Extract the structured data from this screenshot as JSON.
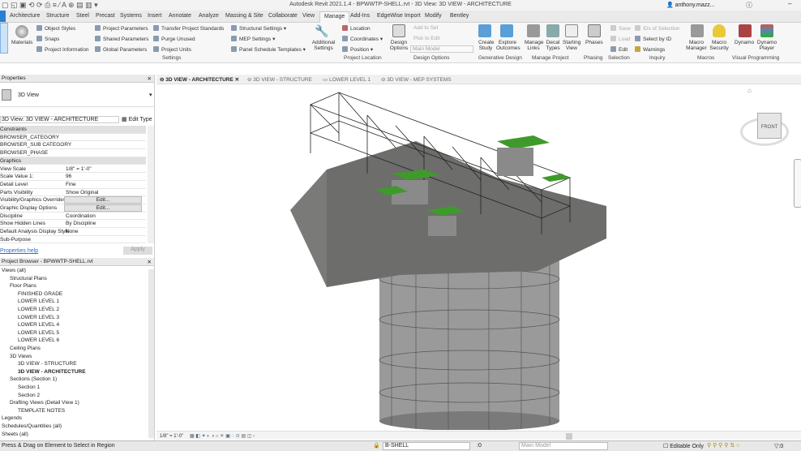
{
  "window": {
    "title": "Autodesk Revit 2021.1.4 - BPWWTP-SHELL.rvt - 3D View: 3D VIEW - ARCHITECTURE",
    "user": "anthony.mazz...",
    "help": "?"
  },
  "tabs": [
    "Architecture",
    "Structure",
    "Steel",
    "Precast",
    "Systems",
    "Insert",
    "Annotate",
    "Analyze",
    "Massing & Site",
    "Collaborate",
    "View",
    "Manage",
    "Add-Ins",
    "EdgeWise Import",
    "Modify",
    "Bentley"
  ],
  "active_tab": "Manage",
  "ribbon": {
    "modify": "Modify",
    "materials": "Materials",
    "settings_items": [
      "Object Styles",
      "Snaps",
      "Project Information",
      "Project Parameters",
      "Shared Parameters",
      "Global Parameters",
      "Transfer Project Standards",
      "Purge Unused",
      "Project Units",
      "Structural Settings",
      "MEP Settings",
      "Panel Schedule Templates"
    ],
    "additional_settings": "Additional Settings",
    "settings_group": "Settings",
    "location_items": [
      "Location",
      "Coordinates",
      "Position"
    ],
    "project_location_group": "Project Location",
    "design_options": "Design Options",
    "add_to_set": "Add to Set",
    "pick_to_edit": "Pick to Edit",
    "main_model": "Main Model",
    "design_options_group": "Design Options",
    "create_study": "Create Study",
    "explore_outcomes": "Explore Outcomes",
    "generative_group": "Generative Design",
    "manage_links": "Manage Links",
    "decal_types": "Decal Types",
    "starting_view": "Starting View",
    "manage_project_group": "Manage Project",
    "phases": "Phases",
    "phasing_group": "Phasing",
    "save": "Save",
    "load": "Load",
    "edit": "Edit",
    "selection_group": "Selection",
    "ids_of_selection": "IDs of Selection",
    "select_by_id": "Select by ID",
    "warnings": "Warnings",
    "inquiry_group": "Inquiry",
    "macro_manager": "Macro Manager",
    "macro_security": "Macro Security",
    "macros_group": "Macros",
    "dynamo": "Dynamo",
    "dynamo_player": "Dynamo Player",
    "visual_programming_group": "Visual Programming"
  },
  "properties": {
    "header": "Properties",
    "type_name": "3D View",
    "view_selector": "3D View: 3D VIEW - ARCHITECTURE",
    "edit_type": "Edit Type",
    "rows": [
      {
        "k": "Constraints",
        "v": "",
        "sec": true
      },
      {
        "k": "BROWSER_CATEGORY",
        "v": ""
      },
      {
        "k": "BROWSER_SUB CATEGORY",
        "v": ""
      },
      {
        "k": "BROWSER_PHASE",
        "v": ""
      },
      {
        "k": "Graphics",
        "v": "",
        "sec": true
      },
      {
        "k": "View Scale",
        "v": "1/8\" = 1'-0\""
      },
      {
        "k": "Scale Value    1:",
        "v": "96"
      },
      {
        "k": "Detail Level",
        "v": "Fine"
      },
      {
        "k": "Parts Visibility",
        "v": "Show Original"
      },
      {
        "k": "Visibility/Graphics Overrides",
        "v": "Edit...",
        "btn": true
      },
      {
        "k": "Graphic Display Options",
        "v": "Edit...",
        "btn": true
      },
      {
        "k": "Discipline",
        "v": "Coordination"
      },
      {
        "k": "Show Hidden Lines",
        "v": "By Discipline"
      },
      {
        "k": "Default Analysis Display Style",
        "v": "None"
      },
      {
        "k": "Sub-Purpose",
        "v": ""
      }
    ],
    "help": "Properties help",
    "apply": "Apply"
  },
  "browser": {
    "header": "Project Browser - BPWWTP-SHELL.rvt",
    "items": [
      {
        "t": "Views (all)",
        "l": 0
      },
      {
        "t": "Structural Plans",
        "l": 1
      },
      {
        "t": "Floor Plans",
        "l": 1
      },
      {
        "t": "FINISHED GRADE",
        "l": 2
      },
      {
        "t": "LOWER LEVEL 1",
        "l": 2
      },
      {
        "t": "LOWER LEVEL 2",
        "l": 2
      },
      {
        "t": "LOWER LEVEL 3",
        "l": 2
      },
      {
        "t": "LOWER LEVEL 4",
        "l": 2
      },
      {
        "t": "LOWER LEVEL 5",
        "l": 2
      },
      {
        "t": "LOWER LEVEL 6",
        "l": 2
      },
      {
        "t": "Ceiling Plans",
        "l": 1
      },
      {
        "t": "3D Views",
        "l": 1
      },
      {
        "t": "3D VIEW -  STRUCTURE",
        "l": 2
      },
      {
        "t": "3D VIEW - ARCHITECTURE",
        "l": 2,
        "bold": true
      },
      {
        "t": "Sections (Section 1)",
        "l": 1
      },
      {
        "t": "Section 1",
        "l": 2
      },
      {
        "t": "Section 2",
        "l": 2
      },
      {
        "t": "Drafting Views (Detail View 1)",
        "l": 1
      },
      {
        "t": "TEMPLATE NOTES",
        "l": 2
      },
      {
        "t": "Legends",
        "l": 0
      },
      {
        "t": "Schedules/Quantities (all)",
        "l": 0
      },
      {
        "t": "Sheets (all)",
        "l": 0
      }
    ]
  },
  "view_tabs": [
    "3D VIEW - ARCHITECTURE",
    "3D VIEW - STRUCTURE",
    "LOWER LEVEL 1",
    "3D VIEW - MEP SYSTEMS"
  ],
  "viewcube": {
    "face": "FRONT"
  },
  "view_control": {
    "scale": "1/8\" = 1'-0\""
  },
  "status": {
    "left": "Press & Drag on Element to Select in Region",
    "workset": "B-SHELL",
    "count": ":0",
    "design_option": "Main Model",
    "editable_only": "Editable Only",
    "filter": ":0"
  },
  "colors": {
    "roof_green": "#3f9a2c",
    "ground": "#6d6d6b",
    "active_tab_bg": "#f7f7f7"
  }
}
